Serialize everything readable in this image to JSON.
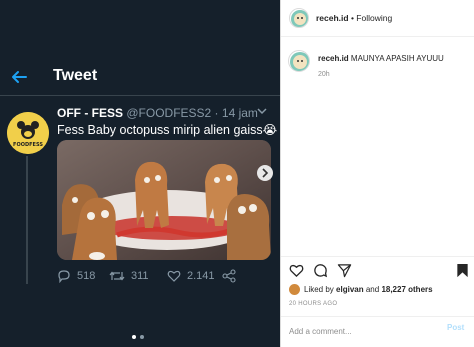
{
  "tweet": {
    "header_title": "Tweet",
    "author_name": "OFF - FESS",
    "author_handle": "@FOODFESS2",
    "separator": " · ",
    "time": "14 jam",
    "text": "Fess Baby octopuss mirip alien gaiss😭",
    "avatar_logo_text": "FOODFESS",
    "replies": "518",
    "retweets": "311",
    "likes": "2.141"
  },
  "instagram": {
    "header_username": "receh.id",
    "header_follow": " • Following",
    "caption_username": "receh.id",
    "caption_text": "MAUNYA APASIH AYUUU",
    "caption_time": "20h",
    "liked_by_prefix": "Liked by ",
    "liked_by_user": "elgivan",
    "liked_by_mid": " and ",
    "liked_by_others": "18,227 others",
    "post_date": "20 HOURS AGO",
    "comment_placeholder": "Add a comment...",
    "post_label": "Post"
  },
  "colors": {
    "twitter_bg": "#15202b",
    "twitter_accent": "#1da1f2",
    "twitter_muted": "#8899a6",
    "instagram_link_disabled": "#b2dffc"
  }
}
